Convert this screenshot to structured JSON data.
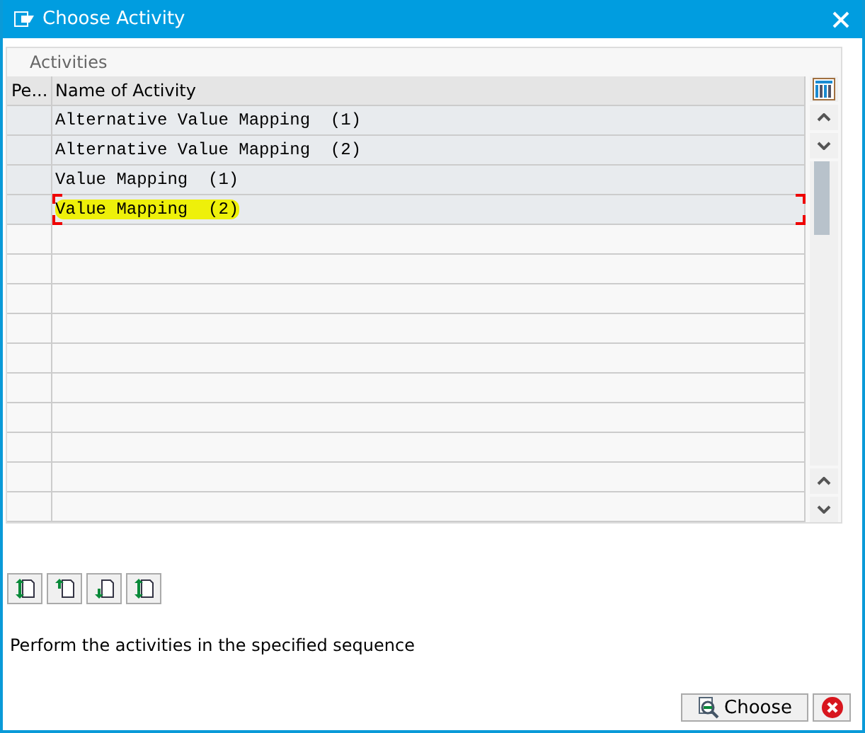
{
  "window": {
    "title": "Choose Activity"
  },
  "table": {
    "title": "Activities",
    "columns": [
      "Pe...",
      "Name of Activity"
    ],
    "rows": [
      {
        "name": "Alternative Value Mapping  (1)",
        "highlighted": false,
        "focused": false
      },
      {
        "name": "Alternative Value Mapping  (2)",
        "highlighted": false,
        "focused": false
      },
      {
        "name": "Value Mapping  (1)",
        "highlighted": false,
        "focused": false
      },
      {
        "name": "Value Mapping  (2)",
        "highlighted": true,
        "focused": true
      }
    ]
  },
  "hint": "Perform the activities in the specified sequence",
  "buttons": [
    {
      "kind": "choose",
      "label": "Choose"
    },
    {
      "kind": "cancel"
    }
  ]
}
